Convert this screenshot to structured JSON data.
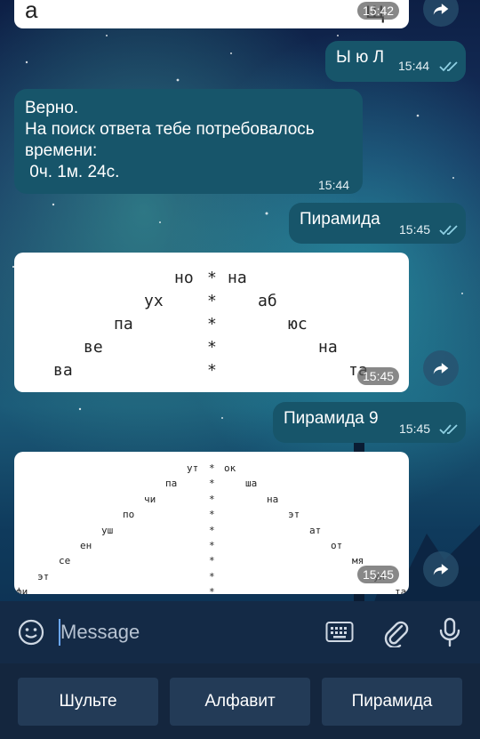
{
  "messages": [
    {
      "type": "card_partial",
      "time": "15:42",
      "text_left": "а",
      "text_right": "щ"
    },
    {
      "type": "out",
      "text": "Ы ю Л",
      "time": "15:44"
    },
    {
      "type": "in",
      "lines": [
        "Верно.",
        "На поиск ответа тебе потребовалось",
        "времени:",
        " 0ч. 1м. 24с."
      ],
      "time": "15:44"
    },
    {
      "type": "out",
      "text": "Пирамида",
      "time": "15:45"
    },
    {
      "type": "card",
      "time": "15:45",
      "rows": [
        {
          "left": "но",
          "mid": "*",
          "right": "на"
        },
        {
          "left": "ух",
          "mid": "*",
          "right": "аб"
        },
        {
          "left": "па",
          "mid": "*",
          "right": "юс"
        },
        {
          "left": "ве",
          "mid": "*",
          "right": "на"
        },
        {
          "left": "ва",
          "mid": "*",
          "right": "та"
        }
      ]
    },
    {
      "type": "out",
      "text": "Пирамида 9",
      "time": "15:45"
    },
    {
      "type": "card",
      "time": "15:45",
      "rows": [
        {
          "left": "ут",
          "mid": "*",
          "right": "ок"
        },
        {
          "left": "па",
          "mid": "*",
          "right": "ша"
        },
        {
          "left": "чи",
          "mid": "*",
          "right": "на"
        },
        {
          "left": "по",
          "mid": "*",
          "right": "эт"
        },
        {
          "left": "уш",
          "mid": "*",
          "right": "ат"
        },
        {
          "left": "ен",
          "mid": "*",
          "right": "от"
        },
        {
          "left": "се",
          "mid": "*",
          "right": "мя"
        },
        {
          "left": "эт",
          "mid": "*",
          "right": "ул"
        },
        {
          "left": "фи",
          "mid": "*",
          "right": "та"
        }
      ]
    }
  ],
  "input": {
    "placeholder": "Message"
  },
  "keyboard": {
    "buttons": [
      "Шульте",
      "Алфавит",
      "Пирамида"
    ]
  },
  "icons": {
    "emoji": "smile-icon",
    "keyboard": "keyboard-icon",
    "attach": "paperclip-icon",
    "mic": "microphone-icon",
    "forward": "forward-arrow-icon"
  }
}
